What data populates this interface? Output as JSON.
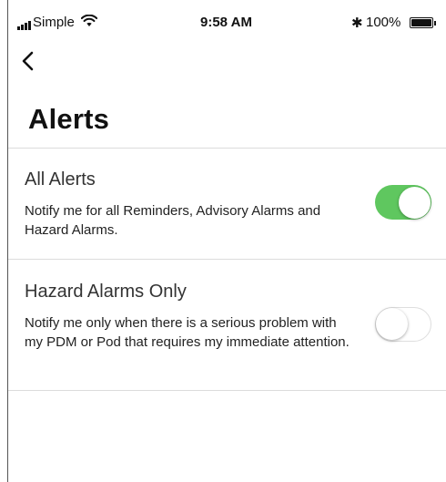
{
  "status_bar": {
    "carrier": "Simple",
    "time": "9:58 AM",
    "bluetooth_icon": "✱",
    "battery_percent": "100%",
    "battery_level": 1.0
  },
  "nav": {
    "back_icon": "chevron-left-icon"
  },
  "page": {
    "title": "Alerts"
  },
  "alerts": [
    {
      "title": "All Alerts",
      "description": "Notify me for all Reminders, Advisory Alarms and Hazard Alarms.",
      "enabled": true
    },
    {
      "title": "Hazard Alarms Only",
      "description": "Notify me only when there is a serious problem with my PDM or Pod that requires my immediate attention.",
      "enabled": false
    }
  ],
  "colors": {
    "toggle_on": "#5fc75f",
    "toggle_off_border": "#dedede"
  }
}
